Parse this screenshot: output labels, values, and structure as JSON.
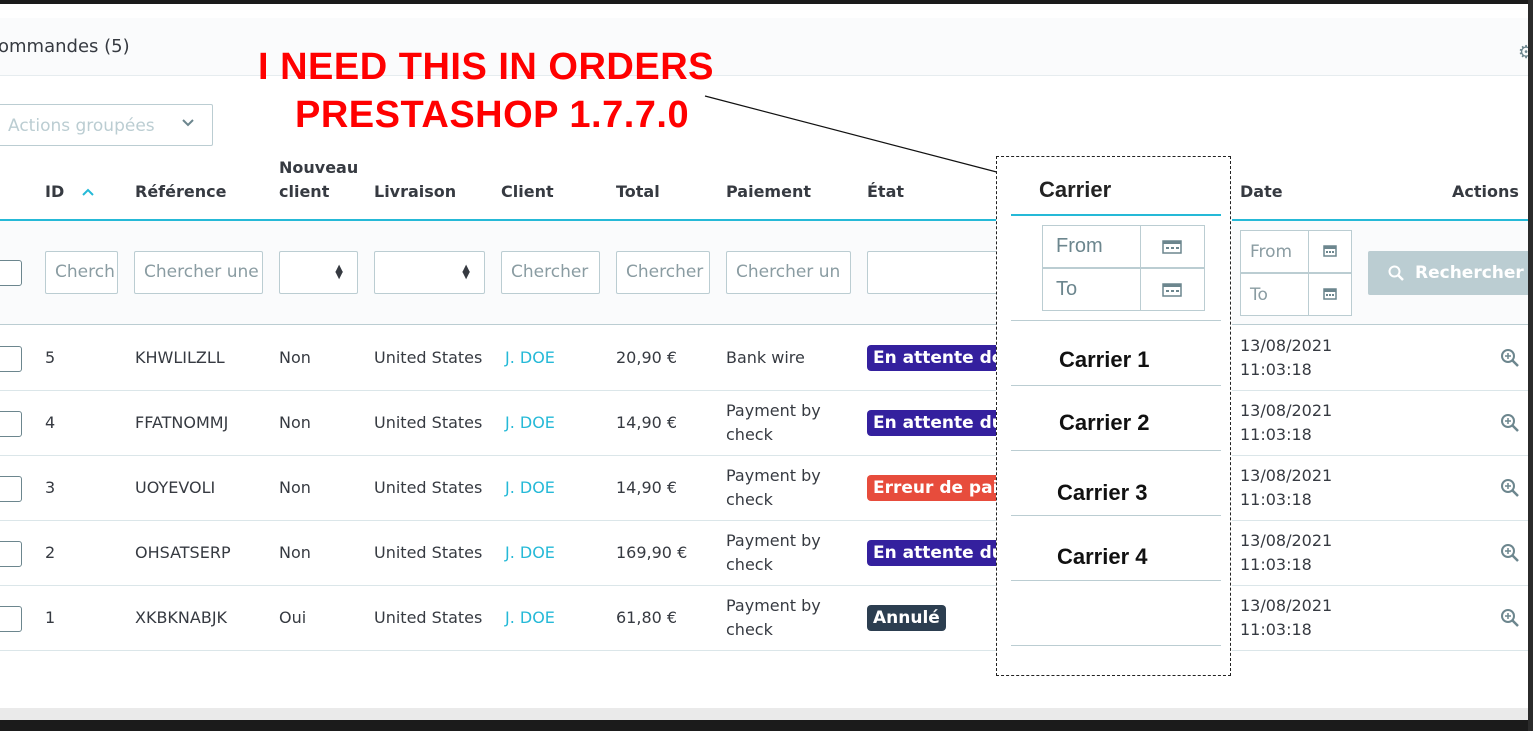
{
  "panel": {
    "title": "ommandes (5)",
    "bulk_actions_label": "Actions groupées"
  },
  "annotation": {
    "line1": "I NEED THIS IN ORDERS",
    "line2": "PRESTASHOP 1.7.7.0"
  },
  "table": {
    "headers": {
      "id": "ID",
      "reference": "Référence",
      "new_client_line1": "Nouveau",
      "new_client_line2": "client",
      "delivery": "Livraison",
      "client": "Client",
      "total": "Total",
      "payment": "Paiement",
      "status": "État",
      "date": "Date",
      "actions": "Actions"
    },
    "filters": {
      "id_placeholder": "Cherch",
      "reference_placeholder": "Chercher une",
      "client_placeholder": "Chercher",
      "total_placeholder": "Chercher",
      "payment_placeholder": "Chercher un",
      "date_from": "From",
      "date_to": "To",
      "search_button": "Rechercher"
    },
    "rows": [
      {
        "id": "5",
        "reference": "KHWLILZLL",
        "new_client": "Non",
        "delivery": "United States",
        "client": "J. DOE",
        "total": "20,90 €",
        "payment_line1": "Bank wire",
        "payment_line2": "",
        "status": "En attente de vir",
        "status_color": "#34209e",
        "date": "13/08/2021",
        "time": "11:03:18"
      },
      {
        "id": "4",
        "reference": "FFATNOMMJ",
        "new_client": "Non",
        "delivery": "United States",
        "client": "J. DOE",
        "total": "14,90 €",
        "payment_line1": "Payment by",
        "payment_line2": "check",
        "status": "En attente du pa",
        "status_color": "#34209e",
        "date": "13/08/2021",
        "time": "11:03:18"
      },
      {
        "id": "3",
        "reference": "UOYEVOLI",
        "new_client": "Non",
        "delivery": "United States",
        "client": "J. DOE",
        "total": "14,90 €",
        "payment_line1": "Payment by",
        "payment_line2": "check",
        "status": "Erreur de paiem",
        "status_color": "#e74c3c",
        "date": "13/08/2021",
        "time": "11:03:18"
      },
      {
        "id": "2",
        "reference": "OHSATSERP",
        "new_client": "Non",
        "delivery": "United States",
        "client": "J. DOE",
        "total": "169,90 €",
        "payment_line1": "Payment by",
        "payment_line2": "check",
        "status": "En attente du pa",
        "status_color": "#34209e",
        "date": "13/08/2021",
        "time": "11:03:18"
      },
      {
        "id": "1",
        "reference": "XKBKNABJK",
        "new_client": "Oui",
        "delivery": "United States",
        "client": "J. DOE",
        "total": "61,80 €",
        "payment_line1": "Payment by",
        "payment_line2": "check",
        "status": "Annulé",
        "status_color": "#2c3e50",
        "date": "13/08/2021",
        "time": "11:03:18"
      }
    ]
  },
  "carrier_mockup": {
    "title": "Carrier",
    "from": "From",
    "to": "To",
    "items": [
      "Carrier 1",
      "Carrier 2",
      "Carrier 3",
      "Carrier 4"
    ]
  },
  "colors": {
    "accent": "#25b9d7",
    "annotation": "#ff0000"
  }
}
